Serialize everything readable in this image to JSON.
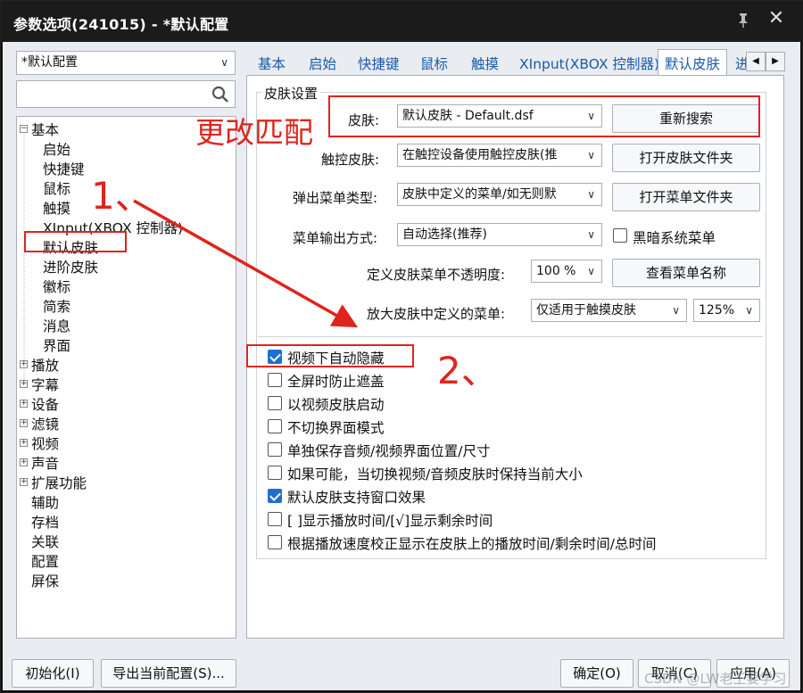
{
  "window": {
    "title": "参数选项(241015) - *默认配置"
  },
  "profile": {
    "selected": "*默认配置"
  },
  "search": {
    "placeholder": ""
  },
  "tree": {
    "items": [
      {
        "label": "基本",
        "expander": "−"
      },
      {
        "label": "启始"
      },
      {
        "label": "快捷键"
      },
      {
        "label": "鼠标"
      },
      {
        "label": "触摸"
      },
      {
        "label": "XInput(XBOX 控制器)"
      },
      {
        "label": "默认皮肤"
      },
      {
        "label": "进阶皮肤"
      },
      {
        "label": "徽标"
      },
      {
        "label": "简索"
      },
      {
        "label": "消息"
      },
      {
        "label": "界面"
      },
      {
        "label": "播放",
        "expander": "+"
      },
      {
        "label": "字幕",
        "expander": "+"
      },
      {
        "label": "设备",
        "expander": "+"
      },
      {
        "label": "滤镜",
        "expander": "+"
      },
      {
        "label": "视频",
        "expander": "+"
      },
      {
        "label": "声音",
        "expander": "+"
      },
      {
        "label": "扩展功能",
        "expander": "+"
      },
      {
        "label": "辅助"
      },
      {
        "label": "存档"
      },
      {
        "label": "关联"
      },
      {
        "label": "配置"
      },
      {
        "label": "屏保"
      }
    ]
  },
  "tabs": [
    "基本",
    "启始",
    "快捷键",
    "鼠标",
    "触摸",
    "XInput(XBOX 控制器)",
    "默认皮肤",
    "进"
  ],
  "group": {
    "title": "皮肤设置"
  },
  "form": {
    "skin_label": "皮肤:",
    "skin_value": "默认皮肤 - Default.dsf",
    "rescan_button": "重新搜索",
    "touch_skin_label": "触控皮肤:",
    "touch_skin_value": "在触控设备使用触控皮肤(推",
    "open_skin_folder_button": "打开皮肤文件夹",
    "popup_menu_label": "弹出菜单类型:",
    "popup_menu_value": "皮肤中定义的菜单/如无则默",
    "open_menu_folder_button": "打开菜单文件夹",
    "menu_output_label": "菜单输出方式:",
    "menu_output_value": "自动选择(推荐)",
    "dark_menu_label": "黑暗系统菜单",
    "opacity_label": "定义皮肤菜单不透明度:",
    "opacity_value": "100 %",
    "view_menu_names_button": "查看菜单名称",
    "enlarge_menu_label": "放大皮肤中定义的菜单:",
    "enlarge_menu_value": "仅适用于触摸皮肤",
    "enlarge_percent_value": "125%"
  },
  "checkboxes": [
    {
      "label": "视频下自动隐藏",
      "checked": true
    },
    {
      "label": "全屏时防止遮盖",
      "checked": false
    },
    {
      "label": "以视频皮肤启动",
      "checked": false
    },
    {
      "label": "不切换界面模式",
      "checked": false
    },
    {
      "label": "单独保存音频/视频界面位置/尺寸",
      "checked": false
    },
    {
      "label": "如果可能，当切换视频/音频皮肤时保持当前大小",
      "checked": false
    },
    {
      "label": "默认皮肤支持窗口效果",
      "checked": true
    },
    {
      "label": "[ ]显示播放时间/[√]显示剩余时间",
      "checked": false
    },
    {
      "label": "根据播放速度校正显示在皮肤上的播放时间/剩余时间/总时间",
      "checked": false
    }
  ],
  "footer": {
    "init_button": "初始化(I)",
    "export_button": "导出当前配置(S)...",
    "ok_button": "确定(O)",
    "cancel_button": "取消(C)",
    "apply_button": "应用(A)"
  },
  "annotations": {
    "note1": "1、",
    "note2": "2、",
    "note3": "更改匹配",
    "color": "#e0241b"
  },
  "watermark": "CSDN @LW老王要学习"
}
